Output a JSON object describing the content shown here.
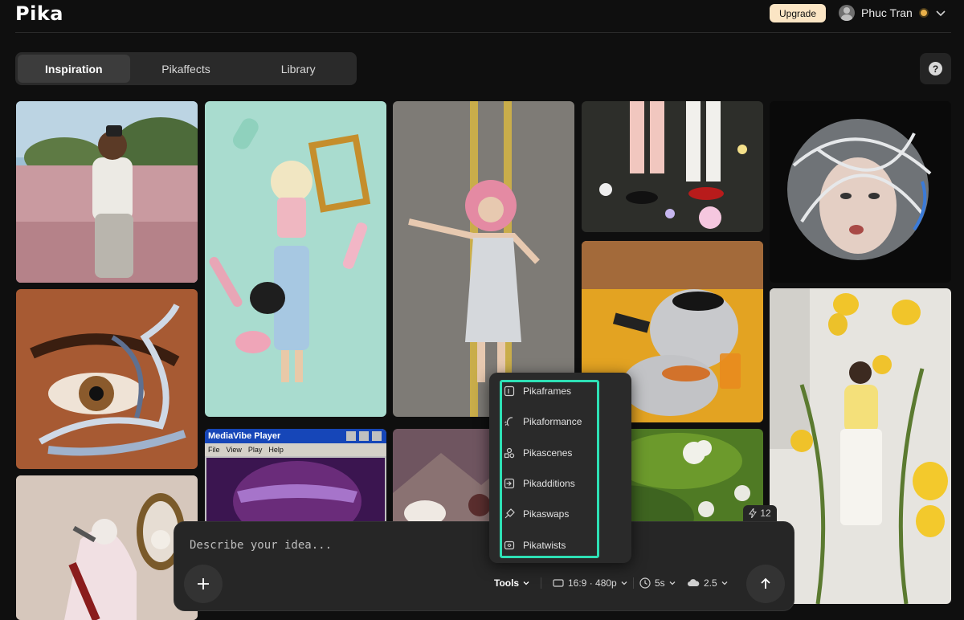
{
  "header": {
    "logo": "Pika",
    "upgrade_label": "Upgrade",
    "user_name": "Phuc Tran"
  },
  "tabs": [
    {
      "label": "Inspiration",
      "active": true
    },
    {
      "label": "Pikaffects",
      "active": false
    },
    {
      "label": "Library",
      "active": false
    }
  ],
  "help_label": "?",
  "gallery": {
    "player_title": "MediaVibe Player",
    "player_menu": [
      "File",
      "View",
      "Play",
      "Help"
    ]
  },
  "tools_menu": {
    "items": [
      {
        "label": "Pikaframes",
        "icon": "frames-icon"
      },
      {
        "label": "Pikaformance",
        "icon": "performance-icon"
      },
      {
        "label": "Pikascenes",
        "icon": "scenes-icon"
      },
      {
        "label": "Pikadditions",
        "icon": "additions-icon"
      },
      {
        "label": "Pikaswaps",
        "icon": "swaps-icon"
      },
      {
        "label": "Pikatwists",
        "icon": "twists-icon"
      }
    ],
    "highlight_color": "#2ee0b5"
  },
  "prompt": {
    "placeholder": "Describe your idea...",
    "tools_label": "Tools",
    "aspect_label": "16:9 · 480p",
    "duration_label": "5s",
    "model_label": "2.5"
  },
  "credits": "12"
}
